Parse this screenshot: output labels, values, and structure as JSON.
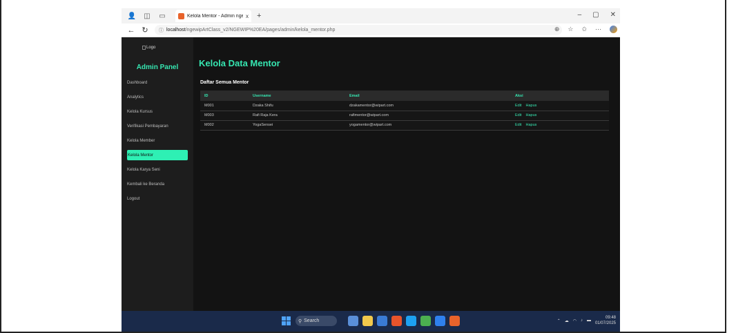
{
  "browser": {
    "tab_title": "Kelola Mentor - Admin ngeWIP",
    "tab_close": "x",
    "new_tab": "+",
    "window_controls": [
      "–",
      "▢",
      "✕"
    ],
    "url_host": "localhost",
    "url_path": "/ngewipArtClass_v2/NGEWIP%20EA/pages/admin/kelola_mentor.php"
  },
  "sidebar": {
    "logo_alt": "Logo",
    "title": "Admin Panel",
    "items": [
      {
        "label": "Dashboard"
      },
      {
        "label": "Analytics"
      },
      {
        "label": "Kelola Kursus"
      },
      {
        "label": "Verifikasi Pembayaran"
      },
      {
        "label": "Kelola Member"
      },
      {
        "label": "Kelola Mentor"
      },
      {
        "label": "Kelola Karya Seni"
      },
      {
        "label": "Kembali ke Beranda"
      },
      {
        "label": "Logout"
      }
    ]
  },
  "main": {
    "title": "Kelola Data Mentor",
    "section_title": "Daftar Semua Mentor",
    "table": {
      "headers": [
        "ID",
        "Username",
        "Email",
        "Aksi"
      ],
      "rows": [
        {
          "id": "M001",
          "username": "Dzaka Shifu",
          "email": "dzakamentor@wipart.com",
          "edit": "Edit",
          "hapus": "Hapus"
        },
        {
          "id": "M003",
          "username": "Rafi Raja Kera",
          "email": "rafimentor@wipart.com",
          "edit": "Edit",
          "hapus": "Hapus"
        },
        {
          "id": "M002",
          "username": "YogaSensei",
          "email": "yogamentor@wipart.com",
          "edit": "Edit",
          "hapus": "Hapus"
        }
      ]
    }
  },
  "taskbar": {
    "search_placeholder": "Search",
    "time": "09:48",
    "date": "01/07/2025"
  },
  "colors": {
    "accent": "#36e6b1",
    "sidebar_bg": "#1d1d1d",
    "main_bg": "#131313"
  }
}
